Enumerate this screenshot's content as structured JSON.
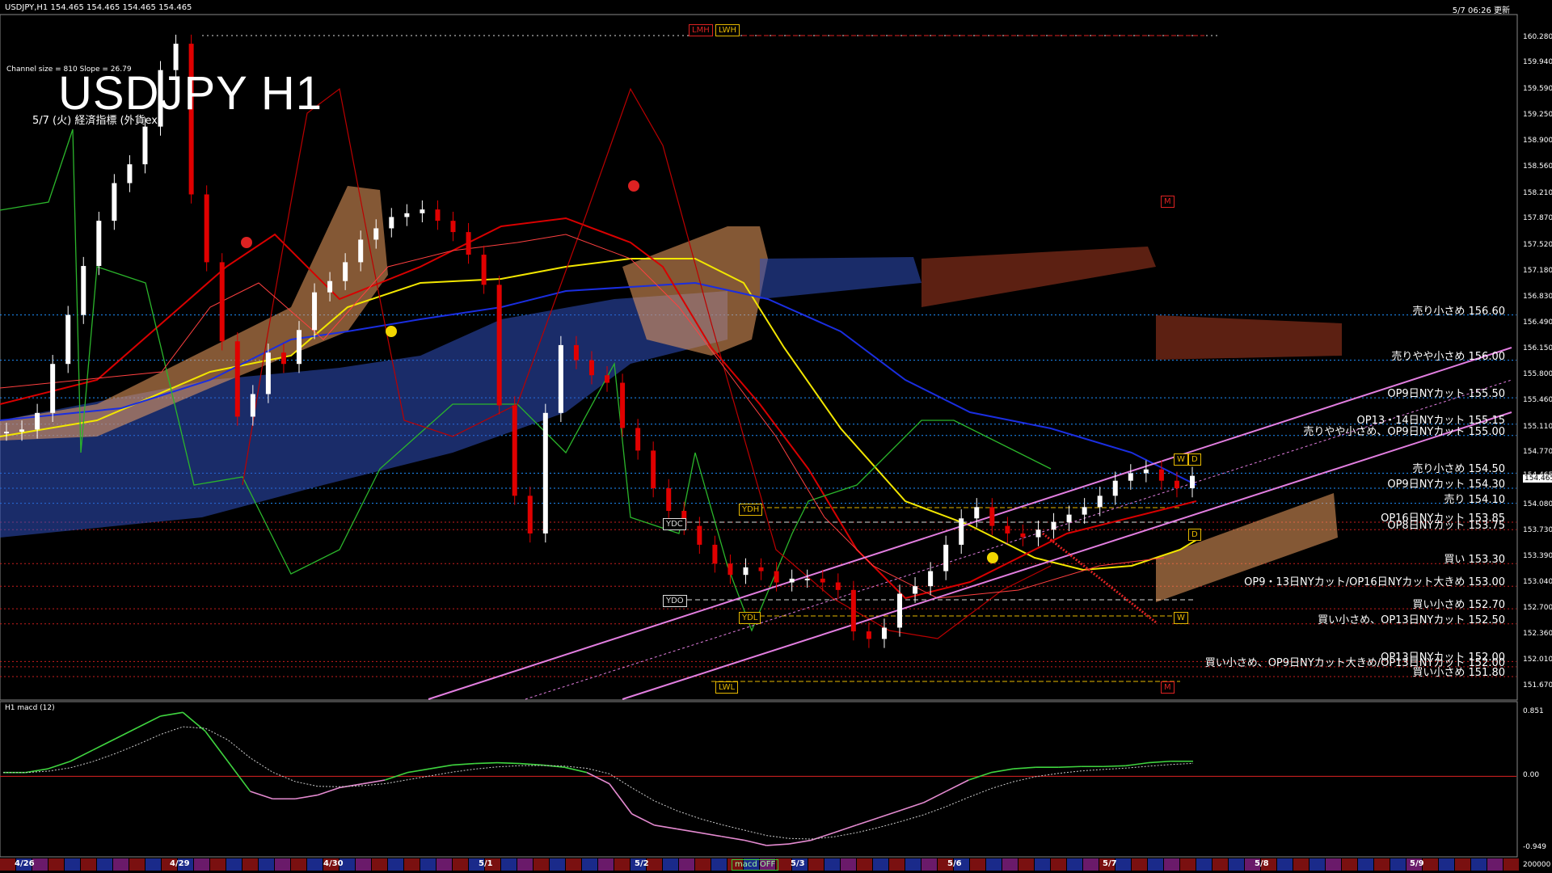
{
  "header": {
    "symbol_line": "USDJPY,H1   154.465  154.465  154.465  154.465",
    "update_time": "5/7 06:26 更新",
    "channel_info": "Channel size = 810  Slope = 26.79",
    "title": "USDJPY H1",
    "subtitle": "5/7 (火) 経済指標 (外貨ex)"
  },
  "indicator": {
    "label": "H1  macd (12)",
    "status_box": "macd OFF"
  },
  "colors": {
    "background": "#000000",
    "price_grid": "#2b59c3",
    "resistance_line": "#1e90ff",
    "support_line": "#c81e1e",
    "candle_up": "#ffffff",
    "candle_down": "#e00000",
    "sma_yellow": "#f2e600",
    "sma_blue": "#1a2ee0",
    "ma_red": "#d80000",
    "channel_pink": "#e27ee0",
    "cloud_orange": "#f0a060",
    "cloud_blue": "#3050c0",
    "chikou_green": "#2bb52b",
    "macd_line": "#3fd43f",
    "macd_neg": "#e48ad0"
  },
  "chart_data": {
    "type": "line",
    "price_axis": [
      "160.280",
      "159.940",
      "159.590",
      "159.250",
      "158.900",
      "158.560",
      "158.210",
      "157.870",
      "157.520",
      "157.180",
      "156.830",
      "156.490",
      "156.150",
      "155.800",
      "155.460",
      "155.110",
      "154.770",
      "154.465",
      "154.080",
      "153.730",
      "153.390",
      "153.040",
      "152.700",
      "152.360",
      "152.010",
      "151.670"
    ],
    "current_price": "154.465",
    "macd_axis": [
      "0.851",
      "0.00",
      "-0.949"
    ],
    "macd_right_scale": "200000",
    "dates": [
      "4/26",
      "4/29",
      "4/30",
      "5/1",
      "5/2",
      "5/3",
      "5/6",
      "5/7",
      "5/8",
      "5/9"
    ],
    "levels": [
      {
        "label": "売り小さめ 156.60",
        "price": 156.6,
        "kind": "resist"
      },
      {
        "label": "売りやや小さめ 156.00",
        "price": 156.0,
        "kind": "resist"
      },
      {
        "label": "OP9日NYカット 155.50",
        "price": 155.5,
        "kind": "resist"
      },
      {
        "label": "OP13・14日NYカット 155.15",
        "price": 155.15,
        "kind": "resist"
      },
      {
        "label": "売りやや小さめ、OP9日NYカット 155.00",
        "price": 155.0,
        "kind": "resist"
      },
      {
        "label": "売り小さめ 154.50",
        "price": 154.5,
        "kind": "resist"
      },
      {
        "label": "OP9日NYカット 154.30",
        "price": 154.3,
        "kind": "resist"
      },
      {
        "label": "売り 154.10",
        "price": 154.1,
        "kind": "resist"
      },
      {
        "label": "OP16日NYカット 153.85",
        "price": 153.85,
        "kind": "support"
      },
      {
        "label": "OP8日NYカット 153.75",
        "price": 153.75,
        "kind": "support"
      },
      {
        "label": "買い 153.30",
        "price": 153.3,
        "kind": "support"
      },
      {
        "label": "OP9・13日NYカット/OP16日NYカット大きめ 153.00",
        "price": 153.0,
        "kind": "support"
      },
      {
        "label": "買い小さめ 152.70",
        "price": 152.7,
        "kind": "support"
      },
      {
        "label": "買い小さめ、OP13日NYカット 152.50",
        "price": 152.5,
        "kind": "support"
      },
      {
        "label": "OP13日NYカット 152.00",
        "price": 152.0,
        "kind": "support"
      },
      {
        "label": "買い小さめ、OP9日NYカット大きめ/OP13日NYカット 152.00",
        "price": 151.93,
        "kind": "support"
      },
      {
        "label": "買い小さめ 151.80",
        "price": 151.8,
        "kind": "support"
      }
    ],
    "tags": {
      "lmh": "LMH",
      "lwh": "LWH",
      "lwl": "LWL",
      "ydh": "YDH",
      "ydl": "YDL",
      "ydc": "YDC",
      "ydo": "YDO",
      "m": "M",
      "w": "W",
      "d": "D"
    },
    "close_series": [
      155.05,
      155.08,
      155.3,
      155.95,
      156.6,
      157.25,
      157.85,
      158.35,
      158.6,
      159.1,
      159.85,
      160.2,
      158.2,
      157.3,
      156.25,
      155.25,
      155.55,
      156.1,
      155.95,
      156.4,
      156.9,
      157.05,
      157.3,
      157.6,
      157.75,
      157.9,
      157.95,
      158.0,
      157.85,
      157.7,
      157.4,
      157.0,
      155.4,
      154.2,
      153.7,
      155.3,
      156.2,
      156.0,
      155.8,
      155.7,
      155.1,
      154.8,
      154.3,
      154.0,
      153.8,
      153.55,
      153.3,
      153.15,
      153.25,
      153.2,
      153.05,
      153.1,
      153.1,
      153.05,
      152.95,
      152.4,
      152.3,
      152.45,
      152.9,
      153.0,
      153.2,
      153.55,
      153.9,
      154.05,
      153.8,
      153.7,
      153.65,
      153.75,
      153.85,
      153.95,
      154.05,
      154.2,
      154.4,
      154.5,
      154.55,
      154.4,
      154.3,
      154.465
    ],
    "macd_series": [
      0.05,
      0.05,
      0.1,
      0.2,
      0.35,
      0.5,
      0.65,
      0.8,
      0.85,
      0.6,
      0.2,
      -0.2,
      -0.3,
      -0.3,
      -0.25,
      -0.15,
      -0.1,
      -0.05,
      0.05,
      0.1,
      0.15,
      0.17,
      0.18,
      0.17,
      0.15,
      0.12,
      0.05,
      -0.1,
      -0.5,
      -0.65,
      -0.7,
      -0.75,
      -0.8,
      -0.85,
      -0.92,
      -0.9,
      -0.85,
      -0.75,
      -0.65,
      -0.55,
      -0.45,
      -0.35,
      -0.2,
      -0.05,
      0.05,
      0.1,
      0.12,
      0.12,
      0.13,
      0.13,
      0.14,
      0.18,
      0.2,
      0.2
    ]
  }
}
